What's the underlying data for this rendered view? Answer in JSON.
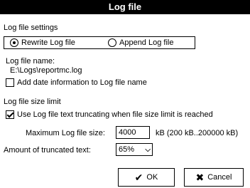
{
  "dialog": {
    "title": "Log file"
  },
  "settings": {
    "section_label": "Log file settings",
    "rewrite_label": "Rewrite Log file",
    "append_label": "Append Log file",
    "selected_mode": "rewrite"
  },
  "filename": {
    "label": "Log file name:",
    "path": "E:\\Logs\\reportmc.log",
    "add_date_label": "Add date information to Log file name",
    "add_date_checked": false
  },
  "size_limit": {
    "section_label": "Log file size limit",
    "truncate_label": "Use Log file text truncating when file size limit is reached",
    "truncate_checked": true,
    "max_size_label": "Maximum Log file size:",
    "max_size_value": "4000",
    "max_size_hint": "kB  (200 kB..200000 kB)",
    "truncated_label": "Amount of truncated text:",
    "truncated_value": "65%"
  },
  "buttons": {
    "ok_label": "OK",
    "cancel_label": "Cancel"
  },
  "icons": {
    "ok_icon": "checkmark-icon",
    "cancel_icon": "x-icon"
  }
}
